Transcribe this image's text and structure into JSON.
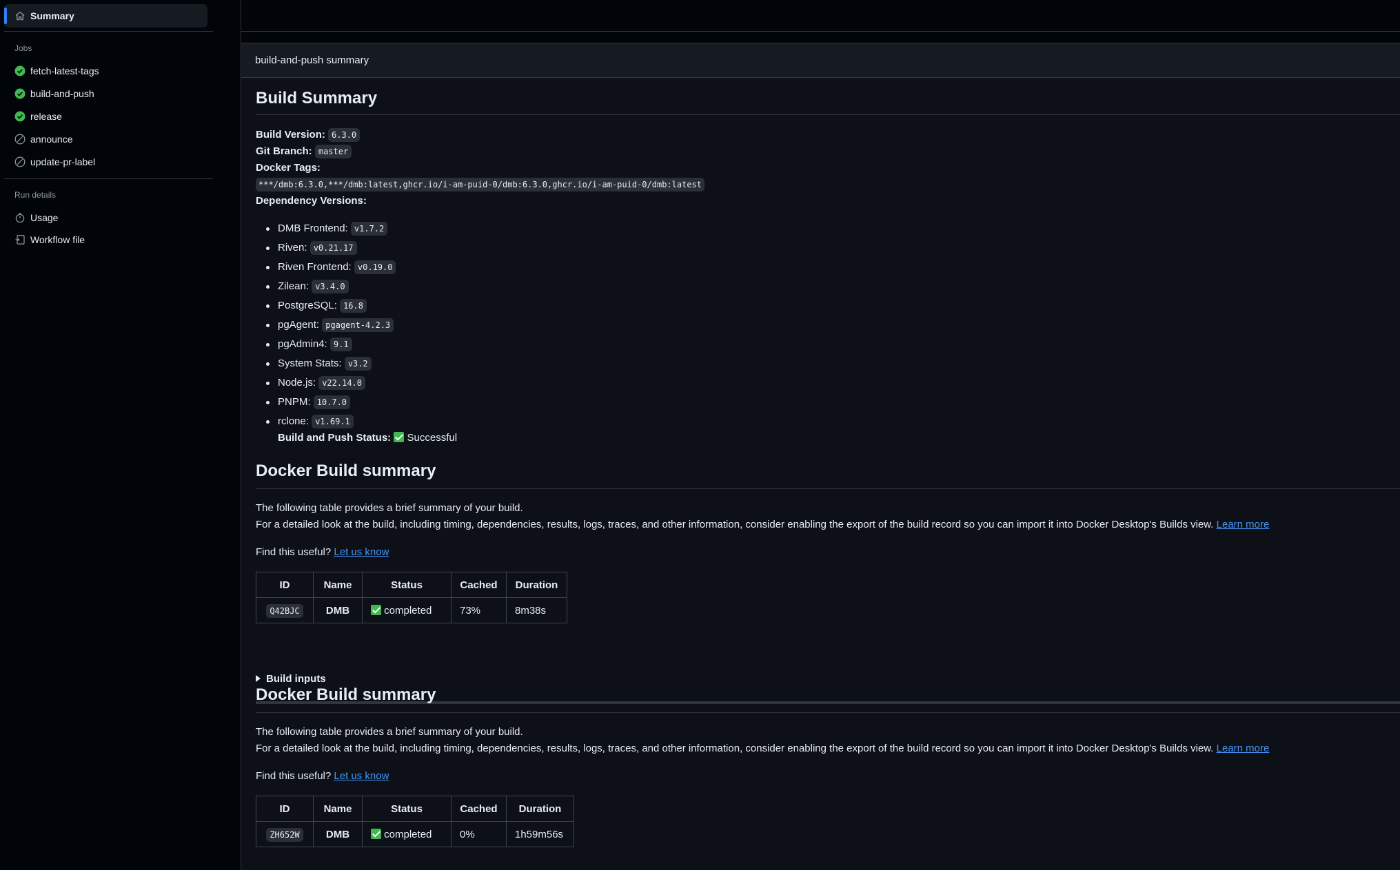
{
  "sidebar": {
    "summary_label": "Summary",
    "jobs_section": "Jobs",
    "jobs": [
      {
        "label": "fetch-latest-tags",
        "status": "success"
      },
      {
        "label": "build-and-push",
        "status": "success"
      },
      {
        "label": "release",
        "status": "success"
      },
      {
        "label": "announce",
        "status": "skipped"
      },
      {
        "label": "update-pr-label",
        "status": "skipped"
      }
    ],
    "run_details_section": "Run details",
    "run_details": [
      {
        "label": "Usage",
        "icon": "stopwatch-icon"
      },
      {
        "label": "Workflow file",
        "icon": "workflow-file-icon"
      }
    ]
  },
  "panel": {
    "title": "build-and-push summary"
  },
  "build_summary": {
    "heading": "Build Summary",
    "version_label": "Build Version:",
    "version": "6.3.0",
    "branch_label": "Git Branch:",
    "branch": "master",
    "tags_label": "Docker Tags:",
    "tags": "***/dmb:6.3.0,***/dmb:latest,ghcr.io/i-am-puid-0/dmb:6.3.0,ghcr.io/i-am-puid-0/dmb:latest",
    "deps_label": "Dependency Versions:",
    "deps": [
      {
        "name": "DMB Frontend:",
        "version": "v1.7.2"
      },
      {
        "name": "Riven:",
        "version": "v0.21.17"
      },
      {
        "name": "Riven Frontend:",
        "version": "v0.19.0"
      },
      {
        "name": "Zilean:",
        "version": "v3.4.0"
      },
      {
        "name": "PostgreSQL:",
        "version": "16.8"
      },
      {
        "name": "pgAgent:",
        "version": "pgagent-4.2.3"
      },
      {
        "name": "pgAdmin4:",
        "version": "9.1"
      },
      {
        "name": "System Stats:",
        "version": "v3.2"
      },
      {
        "name": "Node.js:",
        "version": "v22.14.0"
      },
      {
        "name": "PNPM:",
        "version": "10.7.0"
      },
      {
        "name": "rclone:",
        "version": "v1.69.1"
      }
    ],
    "push_status_label": "Build and Push Status:",
    "push_status": "Successful"
  },
  "docker_summaries": [
    {
      "heading": "Docker Build summary",
      "intro": "The following table provides a brief summary of your build.",
      "detail": "For a detailed look at the build, including timing, dependencies, results, logs, traces, and other information, consider enabling the export of the build record so you can import it into Docker Desktop's Builds view.",
      "learn_more": "Learn more",
      "useful_prompt": "Find this useful?",
      "useful_link": "Let us know",
      "columns": [
        "ID",
        "Name",
        "Status",
        "Cached",
        "Duration"
      ],
      "row": {
        "id": "Q42BJC",
        "name": "DMB",
        "status": "completed",
        "cached": "73%",
        "duration": "8m38s"
      },
      "inputs_label": "Build inputs"
    },
    {
      "heading": "Docker Build summary",
      "intro": "The following table provides a brief summary of your build.",
      "detail": "For a detailed look at the build, including timing, dependencies, results, logs, traces, and other information, consider enabling the export of the build record so you can import it into Docker Desktop's Builds view.",
      "learn_more": "Learn more",
      "useful_prompt": "Find this useful?",
      "useful_link": "Let us know",
      "columns": [
        "ID",
        "Name",
        "Status",
        "Cached",
        "Duration"
      ],
      "row": {
        "id": "ZH652W",
        "name": "DMB",
        "status": "completed",
        "cached": "0%",
        "duration": "1h59m56s"
      }
    }
  ],
  "colors": {
    "accent": "#2f81f7",
    "success": "#3fb950",
    "link": "#4493f8"
  }
}
